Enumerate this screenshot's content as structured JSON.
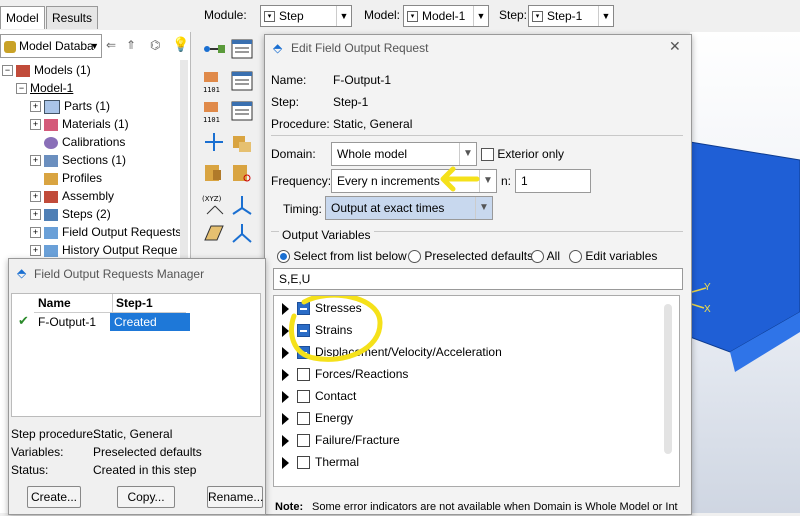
{
  "left_tabs": [
    "Model",
    "Results"
  ],
  "model_db_label": "Model Databa",
  "tree": {
    "root": "Models (1)",
    "model": "Model-1",
    "items": [
      "Parts (1)",
      "Materials (1)",
      "Calibrations",
      "Sections (1)",
      "Profiles",
      "Assembly",
      "Steps (2)",
      "Field Output Requests",
      "History Output Reque"
    ]
  },
  "top_bar": {
    "module_label": "Module:",
    "module_value": "Step",
    "model_label": "Model:",
    "model_value": "Model-1",
    "step_label": "Step:",
    "step_value": "Step-1"
  },
  "viewport": {
    "triad_y": "Y",
    "triad_x": "X",
    "part_color": "#1f5fd6"
  },
  "dialog": {
    "title": "Edit Field Output Request",
    "name_label": "Name:",
    "name_value": "F-Output-1",
    "step_label": "Step:",
    "step_value": "Step-1",
    "procedure_label": "Procedure:",
    "procedure_value": "Static, General",
    "domain_label": "Domain:",
    "domain_value": "Whole model",
    "exterior_only": "Exterior only",
    "frequency_label": "Frequency:",
    "frequency_value": "Every n increments",
    "n_label": "n:",
    "n_value": "1",
    "timing_label": "Timing:",
    "timing_value": "Output at exact times",
    "output_vars_label": "Output Variables",
    "radios": [
      "Select from list below",
      "Preselected defaults",
      "All",
      "Edit variables"
    ],
    "vars_text": "S,E,U",
    "variables": [
      "Stresses",
      "Strains",
      "Displacement/Velocity/Acceleration",
      "Forces/Reactions",
      "Contact",
      "Energy",
      "Failure/Fracture",
      "Thermal"
    ],
    "note_label": "Note:",
    "note_text": "Some error indicators are not available when Domain is Whole Model or Int"
  },
  "manager": {
    "title": "Field Output Requests Manager",
    "col_name": "Name",
    "col_step": "Step-1",
    "row_name": "F-Output-1",
    "row_status": "Created",
    "step_proc_label": "Step procedure:",
    "step_proc_value": "Static, General",
    "variables_label": "Variables:",
    "variables_value": "Preselected defaults",
    "status_label": "Status:",
    "status_value": "Created in this step",
    "buttons": [
      "Create...",
      "Copy...",
      "Rename..."
    ]
  },
  "colors": {
    "accent": "#1a6fd1",
    "annotation": "#f5e11a",
    "selected_cell": "#1e78d8"
  }
}
